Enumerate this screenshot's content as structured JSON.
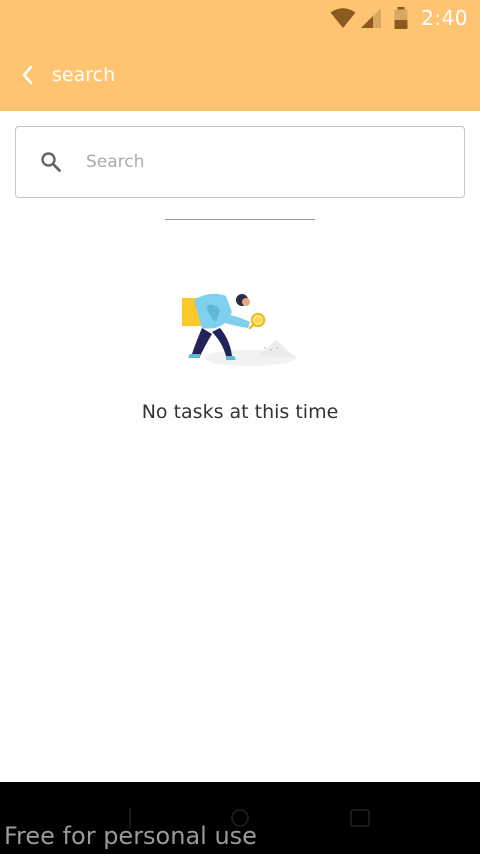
{
  "status_bar": {
    "time": "2:40",
    "icons": [
      "wifi-icon",
      "cellular-signal-icon",
      "battery-icon"
    ]
  },
  "toolbar": {
    "back_icon": "chevron-left-icon",
    "title": "search"
  },
  "search": {
    "icon": "search-icon",
    "placeholder": "Search",
    "value": ""
  },
  "empty_state": {
    "illustration": "searching-person-illustration",
    "message": "No tasks at this time"
  },
  "nav_bar": {
    "buttons": [
      "back-nav-icon",
      "home-nav-icon",
      "recents-nav-icon"
    ]
  },
  "watermark": {
    "text": "Free for personal use"
  },
  "colors": {
    "header_bg": "#FFC472",
    "header_text": "#FFFFFF",
    "body_text": "#333333",
    "placeholder": "#AAAAAA",
    "nav_bar_bg": "#000000"
  }
}
